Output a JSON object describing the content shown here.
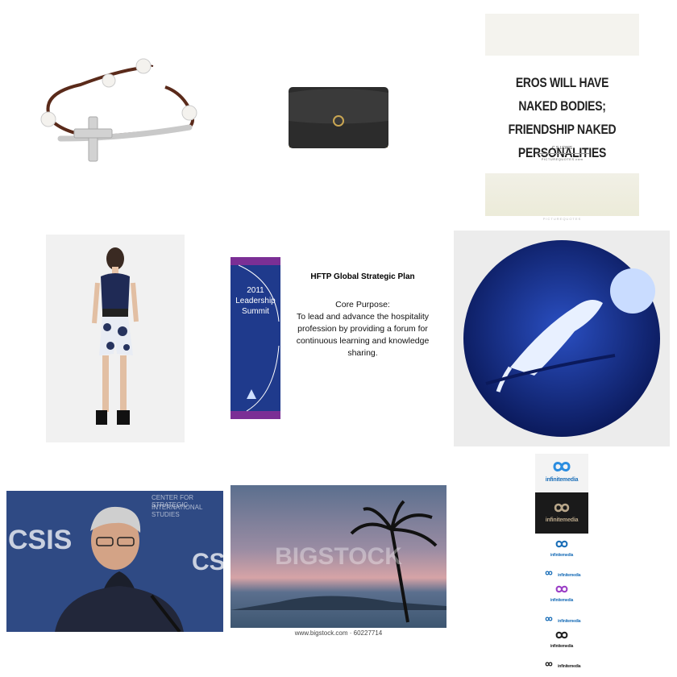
{
  "tiles": {
    "bracelet": {
      "alt": "leather bracelet with silver cross"
    },
    "handbag": {
      "alt": "black wallet on chain"
    },
    "quote": {
      "text": "EROS WILL HAVE NAKED BODIES; FRIENDSHIP NAKED PERSONALITIES",
      "author": "C.S.LEWIS",
      "site": "PICTUREQUOTES.com",
      "footer": "PICTUREQUOTES"
    },
    "fashion": {
      "alt": "woman in navy top and floral shorts"
    },
    "hftp": {
      "banner": "2011 Leadership Summit",
      "title": "HFTP Global Strategic Plan",
      "core_purpose_label": "Core Purpose:",
      "core_purpose": "To lead and advance the hospitality profession by providing a forum for continuous learning and knowledge sharing."
    },
    "cat_moon": {
      "alt": "cat leaping toward the moon round sticker"
    },
    "speaker": {
      "backdrop_labels": [
        "CSIS",
        "CSIS",
        "CENTER FOR STRATEGIC",
        "INTERNATIONAL STUDIES"
      ]
    },
    "bigstock": {
      "watermark": "BIGSTOCK",
      "url": "www.bigstock.com · 60227714"
    },
    "logos": {
      "brand": "infinitemedia",
      "brand_prefix": "infinite",
      "brand_suffix": "media"
    }
  },
  "colors": {
    "hftp_blue": "#1f3a8c",
    "hftp_purple": "#7b2f95",
    "logo_blue": "#1c6fb8"
  }
}
